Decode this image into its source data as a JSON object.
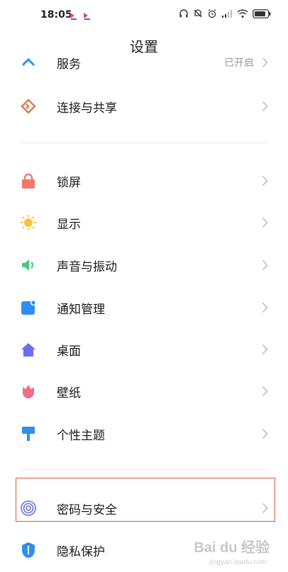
{
  "status": {
    "time": "18:05"
  },
  "header": {
    "title": "设置"
  },
  "partial_row": {
    "label": "服务",
    "value": "已开启"
  },
  "group1": [
    {
      "label": "连接与共享",
      "icon": "share-icon",
      "color": "#e07a55"
    }
  ],
  "group2": [
    {
      "label": "锁屏",
      "icon": "lock-icon",
      "color": "#ef7a6b"
    },
    {
      "label": "显示",
      "icon": "sun-icon",
      "color": "#f5c341"
    },
    {
      "label": "声音与振动",
      "icon": "speaker-icon",
      "color": "#3fcf7a"
    },
    {
      "label": "通知管理",
      "icon": "notification-icon",
      "color": "#2f8ff0"
    },
    {
      "label": "桌面",
      "icon": "home-icon",
      "color": "#6f6cf2"
    },
    {
      "label": "壁纸",
      "icon": "tulip-icon",
      "color": "#f06d8d"
    },
    {
      "label": "个性主题",
      "icon": "brush-icon",
      "color": "#2f8ff0"
    }
  ],
  "group3": [
    {
      "label": "密码与安全",
      "icon": "fingerprint-icon",
      "color": "#7c7fe0"
    },
    {
      "label": "隐私保护",
      "icon": "shield-icon",
      "color": "#2f8ff0"
    }
  ],
  "watermark": {
    "text": "Bai du 经验",
    "sub": "jingyan.baidu.com"
  }
}
